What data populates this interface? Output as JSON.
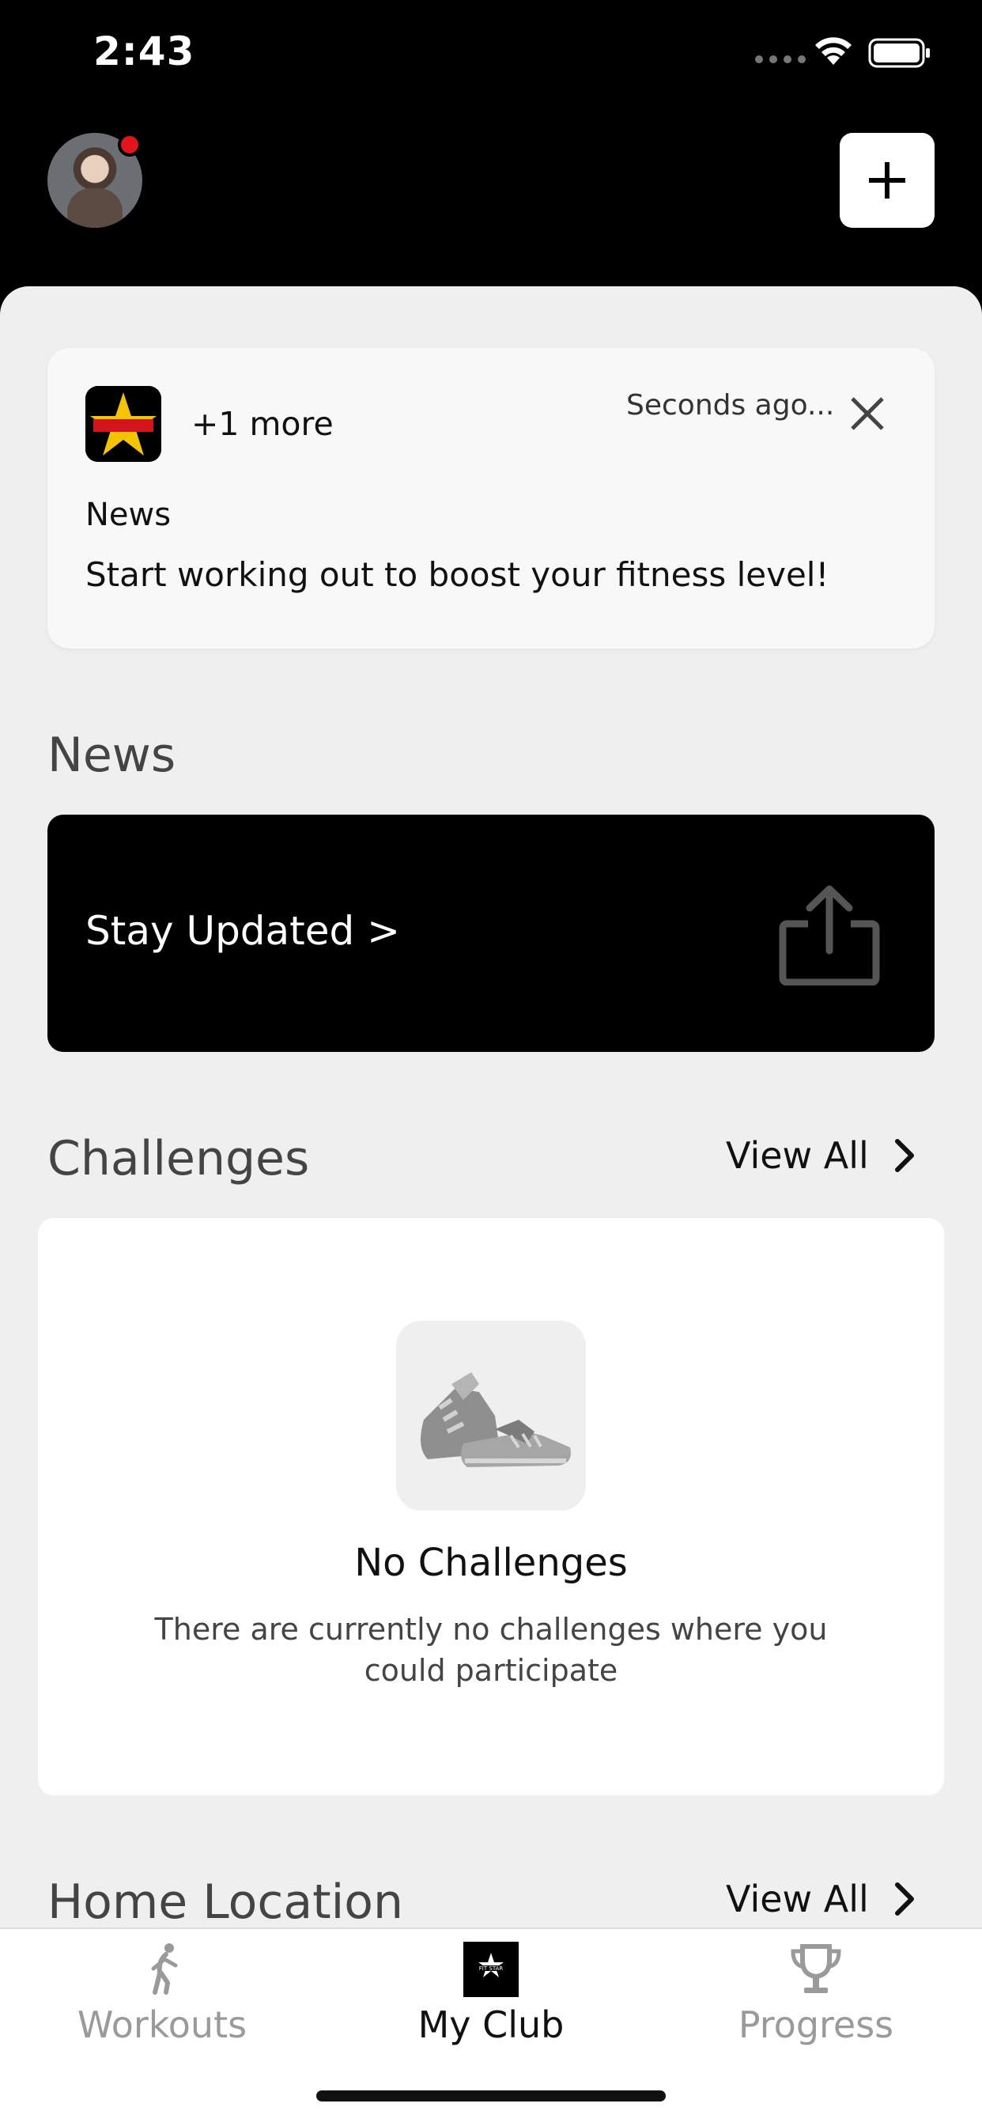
{
  "status_bar": {
    "time": "2:43"
  },
  "header": {
    "add_label": "+"
  },
  "notification": {
    "more": "+1 more",
    "time": "Seconds ago...",
    "title": "News",
    "body": "Start working out to boost your fitness level!",
    "logo_text": "FIT STAR"
  },
  "news": {
    "heading": "News",
    "banner_label": "Stay Updated >"
  },
  "challenges": {
    "heading": "Challenges",
    "view_all": "View All",
    "empty_title": "No Challenges",
    "empty_description": "There are currently no challenges where you could participate"
  },
  "home_location": {
    "heading": "Home Location",
    "view_all": "View All"
  },
  "tabs": [
    {
      "label": "Workouts",
      "icon": "figure-icon",
      "active": false
    },
    {
      "label": "My Club",
      "icon": "club-logo-icon",
      "active": true
    },
    {
      "label": "Progress",
      "icon": "trophy-icon",
      "active": false
    }
  ],
  "colors": {
    "header_bg": "#000000",
    "sheet_bg": "#efefef",
    "notification_dot": "#e1151b",
    "inactive_tab": "#9a9a9a"
  }
}
